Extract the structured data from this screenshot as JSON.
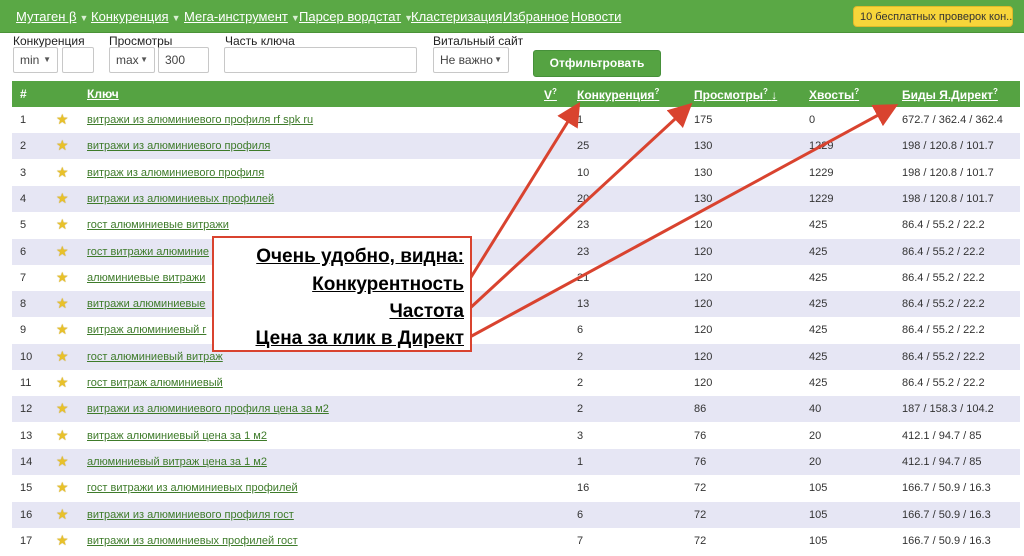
{
  "nav": {
    "items": [
      {
        "label": "Мутаген β",
        "dropdown": true
      },
      {
        "label": "Конкуренция",
        "dropdown": true
      },
      {
        "label": "Мега-инструмент",
        "dropdown": true
      },
      {
        "label": "Парсер вордстат",
        "dropdown": true
      },
      {
        "label": "Кластеризация",
        "dropdown": false
      },
      {
        "label": "Избранное",
        "dropdown": false
      },
      {
        "label": "Новости",
        "dropdown": false
      }
    ],
    "promo": "10 бесплатных проверок кон..."
  },
  "filters": {
    "competition_label": "Конкуренция",
    "competition_select": "min",
    "competition_value": "",
    "views_label": "Просмотры",
    "views_select": "max",
    "views_value": "300",
    "key_part_label": "Часть ключа",
    "key_part_value": "",
    "vital_label": "Витальный сайт",
    "vital_select": "Не важно",
    "submit_label": "Отфильтровать"
  },
  "table": {
    "columns": {
      "num": "#",
      "key": "Ключ",
      "v": "V",
      "competition": "Конкуренция",
      "views": "Просмотры",
      "tails": "Хвосты",
      "bids": "Биды Я.Директ"
    },
    "sort_indicator": "↓",
    "help_mark": "?",
    "rows": [
      {
        "n": "1",
        "key": "витражи из алюминиевого профиля rf spk ru",
        "competition": "1",
        "views": "175",
        "tails": "0",
        "bids": "672.7 / 362.4 / 362.4"
      },
      {
        "n": "2",
        "key": "витражи из алюминиевого профиля",
        "competition": "25",
        "views": "130",
        "tails": "1229",
        "bids": "198 / 120.8 / 101.7"
      },
      {
        "n": "3",
        "key": "витраж из алюминиевого профиля",
        "competition": "10",
        "views": "130",
        "tails": "1229",
        "bids": "198 / 120.8 / 101.7"
      },
      {
        "n": "4",
        "key": "витражи из алюминиевых профилей",
        "competition": "20",
        "views": "130",
        "tails": "1229",
        "bids": "198 / 120.8 / 101.7"
      },
      {
        "n": "5",
        "key": "гост алюминиевые витражи",
        "competition": "23",
        "views": "120",
        "tails": "425",
        "bids": "86.4 / 55.2 / 22.2"
      },
      {
        "n": "6",
        "key": "гост витражи алюминие",
        "competition": "23",
        "views": "120",
        "tails": "425",
        "bids": "86.4 / 55.2 / 22.2"
      },
      {
        "n": "7",
        "key": "алюминиевые витражи",
        "competition": "21",
        "views": "120",
        "tails": "425",
        "bids": "86.4 / 55.2 / 22.2"
      },
      {
        "n": "8",
        "key": "витражи алюминиевые",
        "competition": "13",
        "views": "120",
        "tails": "425",
        "bids": "86.4 / 55.2 / 22.2"
      },
      {
        "n": "9",
        "key": "витраж алюминиевый г",
        "competition": "6",
        "views": "120",
        "tails": "425",
        "bids": "86.4 / 55.2 / 22.2"
      },
      {
        "n": "10",
        "key": "гост алюминиевый витраж",
        "competition": "2",
        "views": "120",
        "tails": "425",
        "bids": "86.4 / 55.2 / 22.2"
      },
      {
        "n": "11",
        "key": "гост витраж алюминиевый",
        "competition": "2",
        "views": "120",
        "tails": "425",
        "bids": "86.4 / 55.2 / 22.2"
      },
      {
        "n": "12",
        "key": "витражи из алюминиевого профиля цена за м2",
        "competition": "2",
        "views": "86",
        "tails": "40",
        "bids": "187 / 158.3 / 104.2"
      },
      {
        "n": "13",
        "key": "витраж алюминиевый цена за 1 м2",
        "competition": "3",
        "views": "76",
        "tails": "20",
        "bids": "412.1 / 94.7 / 85"
      },
      {
        "n": "14",
        "key": "алюминиевый витраж цена за 1 м2",
        "competition": "1",
        "views": "76",
        "tails": "20",
        "bids": "412.1 / 94.7 / 85"
      },
      {
        "n": "15",
        "key": "гост витражи из алюминиевых профилей",
        "competition": "16",
        "views": "72",
        "tails": "105",
        "bids": "166.7 / 50.9 / 16.3"
      },
      {
        "n": "16",
        "key": "витражи из алюминиевого профиля гост",
        "competition": "6",
        "views": "72",
        "tails": "105",
        "bids": "166.7 / 50.9 / 16.3"
      },
      {
        "n": "17",
        "key": "витражи из алюминиевых профилей гост",
        "competition": "7",
        "views": "72",
        "tails": "105",
        "bids": "166.7 / 50.9 / 16.3"
      }
    ]
  },
  "annotation": {
    "lines": [
      "Очень удобно, видна:",
      "Конкурентность",
      "Частота",
      "Цена за клик в Директ"
    ],
    "color": "#d9432f"
  },
  "colors": {
    "nav_bg": "#5aa845",
    "header_bg": "#55a342",
    "row_alt_bg": "#e6e6f4",
    "link": "#3e7b2a",
    "promo_bg": "#f7d53a"
  }
}
